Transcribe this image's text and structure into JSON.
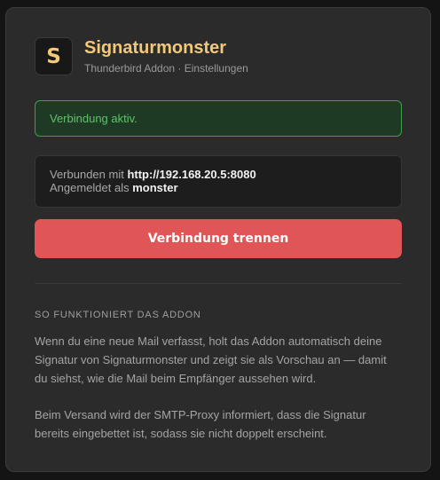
{
  "header": {
    "logo_letter": "S",
    "title": "Signaturmonster",
    "subtitle": "Thunderbird Addon · Einstellungen"
  },
  "status": {
    "text": "Verbindung aktiv."
  },
  "connection": {
    "connected_prefix": "Verbunden mit ",
    "server_url": "http://192.168.20.5:8080",
    "logged_in_prefix": "Angemeldet als ",
    "username": "monster"
  },
  "actions": {
    "disconnect_label": "Verbindung trennen"
  },
  "about": {
    "heading": "SO FUNKTIONIERT DAS ADDON",
    "paragraph1": "Wenn du eine neue Mail verfasst, holt das Addon automatisch deine Signatur von Signaturmonster und zeigt sie als Vorschau an — damit du siehst, wie die Mail beim Empfänger aussehen wird.",
    "paragraph2": "Beim Versand wird der SMTP-Proxy informiert, dass die Signatur bereits eingebettet ist, sodass sie nicht doppelt erscheint."
  },
  "colors": {
    "accent": "#f2c879",
    "success": "#5fc26b",
    "danger": "#e05555",
    "card_bg": "#2b2b2b"
  }
}
